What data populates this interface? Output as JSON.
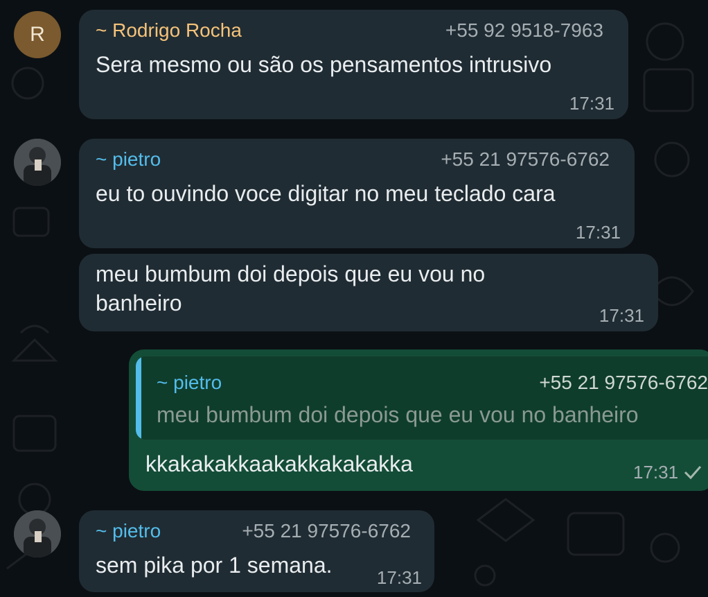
{
  "messages": [
    {
      "sender": "~ Rodrigo Rocha",
      "phone": "+55 92 9518-7963",
      "avatar_letter": "R",
      "text": "Sera mesmo ou são os pensamentos intrusivo",
      "time": "17:31"
    },
    {
      "sender": "~ pietro",
      "phone": "+55 21 97576-6762",
      "text": "eu to ouvindo voce digitar no meu teclado cara",
      "time": "17:31"
    },
    {
      "text_line1": "meu bumbum doi depois que eu vou no",
      "text_line2": "banheiro",
      "time": "17:31"
    },
    {
      "quote_sender": "~ pietro",
      "quote_phone": "+55 21 97576-6762",
      "quote_text": "meu bumbum doi depois que eu vou no banheiro",
      "text": "kkakakakkaakakkakakakka",
      "time": "17:31"
    },
    {
      "sender": "~ pietro",
      "phone": "+55 21 97576-6762",
      "text": "sem pika por 1 semana.",
      "time": "17:31"
    }
  ],
  "colors": {
    "incoming_bubble": "#202c33",
    "outgoing_bubble": "#144d37",
    "sender_yellow": "#f5c37a",
    "sender_blue": "#53bdeb",
    "background": "#0b1014"
  },
  "icons": {
    "check": "single-check-icon"
  }
}
